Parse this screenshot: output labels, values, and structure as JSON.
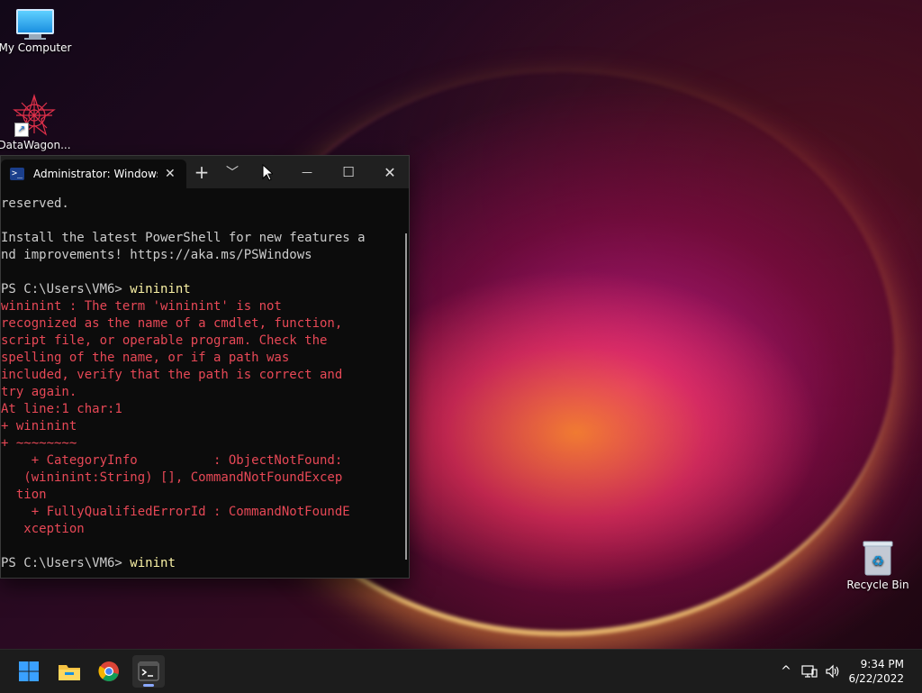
{
  "desktop": {
    "icons": [
      {
        "label": "My Computer"
      },
      {
        "label": "DataWagon..."
      },
      {
        "label": "Recycle Bin"
      }
    ]
  },
  "terminal": {
    "tab_title": "Administrator: Windows F",
    "tab_icon_glyph": ">_",
    "new_tab_glyph": "+",
    "dropdown_glyph": "﹀",
    "minimize_glyph": "—",
    "maximize_glyph": "☐",
    "close_glyph": "✕",
    "lines": [
      "reserved.",
      "",
      "Install the latest PowerShell for new features a",
      "nd improvements! https://aka.ms/PSWindows",
      "",
      "PS C:\\Users\\VM6> ",
      "wininint : The term 'wininint' is not",
      "recognized as the name of a cmdlet, function,",
      "script file, or operable program. Check the",
      "spelling of the name, or if a path was",
      "included, verify that the path is correct and",
      "try again.",
      "At line:1 char:1",
      "+ wininint",
      "+ ~~~~~~~~",
      "    + CategoryInfo          : ObjectNotFound:",
      "   (wininint:String) [], CommandNotFoundExcep",
      "  tion",
      "    + FullyQualifiedErrorId : CommandNotFoundE",
      "   xception",
      "",
      "PS C:\\Users\\VM6> "
    ],
    "cmd1": "wininint",
    "cmd2": "winint"
  },
  "taskbar": {
    "clock_time": "9:34 PM",
    "clock_date": "6/22/2022",
    "tray_chevron": "^"
  },
  "colors": {
    "error_red": "#e74856",
    "command_yellow": "#f9f1a5",
    "terminal_bg": "#0c0c0c"
  }
}
